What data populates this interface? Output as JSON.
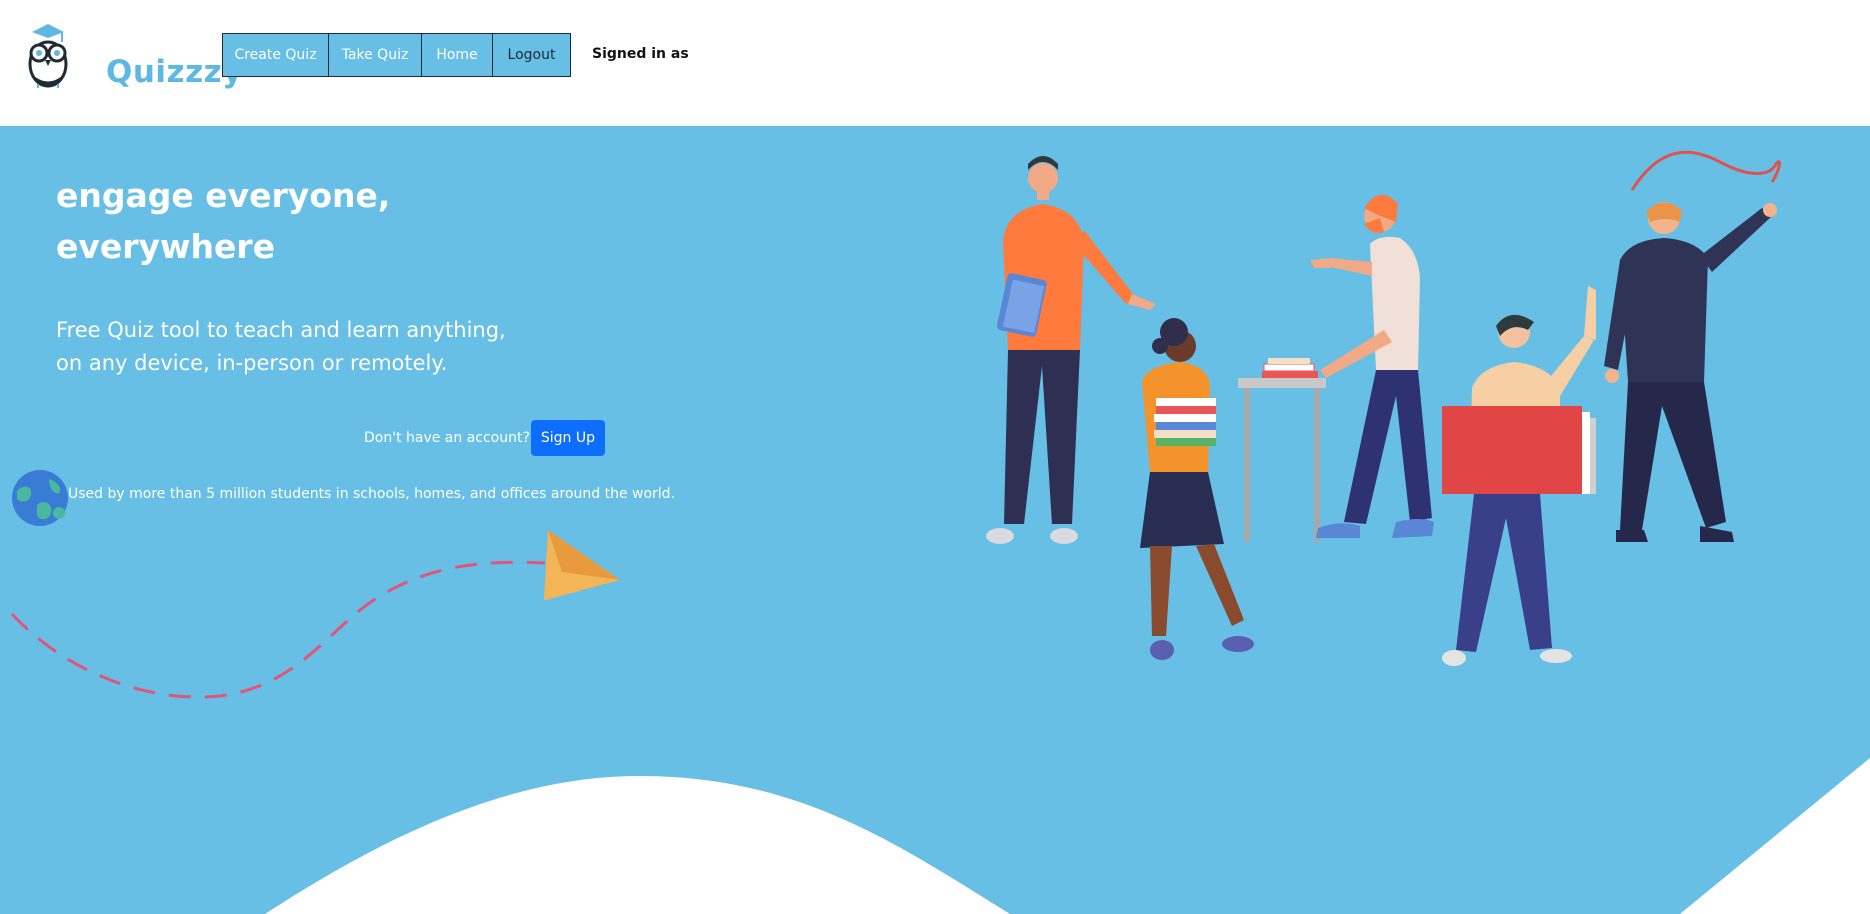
{
  "brand": {
    "name": "Quizzzy",
    "logo_icon": "owl-graduate-icon",
    "color": "#5db8e2"
  },
  "nav": {
    "items": [
      {
        "label": "Create Quiz"
      },
      {
        "label": "Take Quiz"
      },
      {
        "label": "Home"
      },
      {
        "label": "Logout"
      }
    ]
  },
  "user": {
    "signed_in_label": "Signed in as"
  },
  "hero": {
    "headline": "engage everyone, everywhere",
    "tagline": "Free Quiz tool to teach and learn anything, on any device, in-person or remotely.",
    "account_prompt": "Don't have an account?",
    "signup_label": "Sign Up",
    "usage_text": "Used by more than 5 million students in schools, homes, and offices around the world.",
    "globe_icon": "globe-icon",
    "plane_icon": "paper-plane-icon",
    "illustration": "people-learning-illustration"
  },
  "colors": {
    "hero_bg": "#67bfe6",
    "nav_bg": "#67bfe6",
    "signup_bg": "#0d6efd",
    "dash": "#e0567a"
  }
}
